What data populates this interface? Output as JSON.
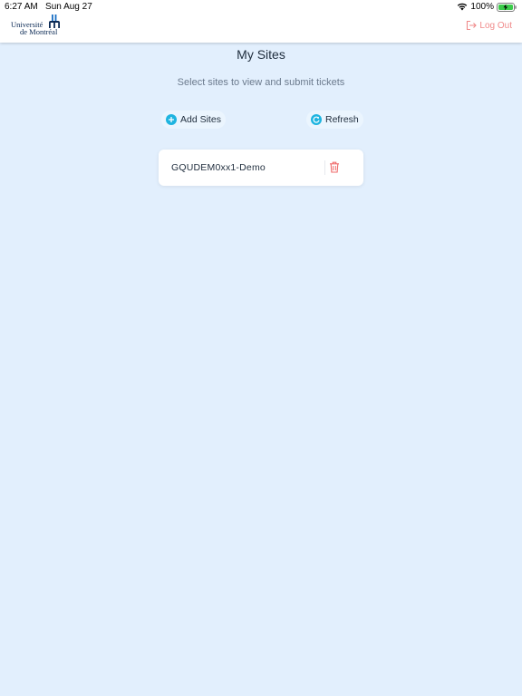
{
  "status_bar": {
    "time": "6:27 AM",
    "date": "Sun Aug 27",
    "battery_percent": "100%"
  },
  "header": {
    "logo_line1": "Université",
    "logo_line2": "de Montréal",
    "logout_label": "Log Out"
  },
  "page": {
    "title": "My Sites",
    "subtitle": "Select sites to view and submit tickets"
  },
  "actions": {
    "add_label": "Add Sites",
    "refresh_label": "Refresh"
  },
  "sites": [
    {
      "name": "GQUDEM0xx1-Demo"
    }
  ],
  "colors": {
    "background": "#e2effd",
    "accent": "#1eb4e0",
    "logout": "#f08a8a",
    "delete": "#ef6b6b",
    "logo": "#0b2a55"
  },
  "icons": {
    "add": "plus-circle-icon",
    "refresh": "refresh-icon",
    "logout": "logout-icon",
    "delete": "trash-icon",
    "wifi": "wifi-icon",
    "battery": "battery-charging-icon"
  }
}
